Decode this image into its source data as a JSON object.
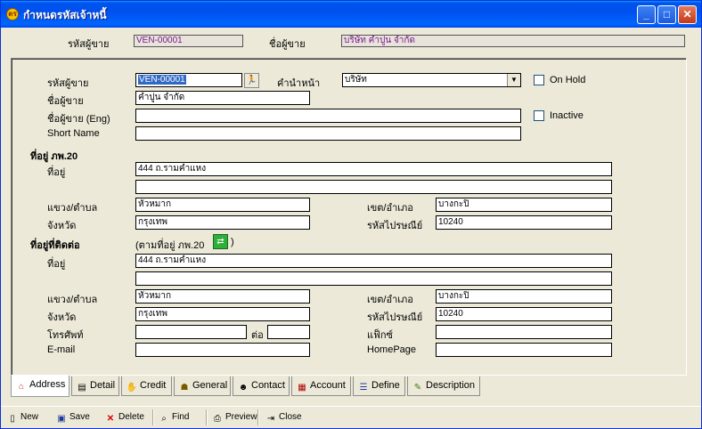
{
  "window": {
    "title": "กำหนดรหัสเจ้าหนี้",
    "app_icon_text": "ตร",
    "min": "_",
    "max": "□",
    "close": "✕"
  },
  "header": {
    "vendor_code_label": "รหัสผู้ขาย",
    "vendor_code": "VEN-00001",
    "vendor_name_label": "ชื่อผู้ขาย",
    "vendor_name": "บริษัท คำปูน จำกัด"
  },
  "form": {
    "vendor_code_label": "รหัสผู้ขาย",
    "vendor_code": "VEN-00001",
    "prefix_label": "คำนำหน้า",
    "prefix_value": "บริษัท",
    "on_hold_label": "On Hold",
    "name_label": "ชื่อผู้ขาย",
    "name_value": "คำปูน จำกัด",
    "name_eng_label": "ชื่อผู้ขาย (Eng)",
    "name_eng_value": "",
    "inactive_label": "Inactive",
    "short_name_label": "Short Name",
    "short_name_value": ""
  },
  "tax_address": {
    "section_title": "ที่อยู่ ภพ.20",
    "address_label": "ที่อยู่",
    "address_line1": "444  ถ.รามคำแหง",
    "address_line2": "",
    "subdistrict_label": "แขวง/ตำบล",
    "subdistrict": "หัวหมาก",
    "district_label": "เขต/อำเภอ",
    "district": "บางกะปิ",
    "province_label": "จังหวัด",
    "province": "กรุงเทพ",
    "postcode_label": "รหัสไปรษณีย์",
    "postcode": "10240"
  },
  "contact_address": {
    "section_title": "ที่อยู่ที่ติดต่อ",
    "same_as_label_open": "(ตามที่อยู่ ภพ.20",
    "same_as_label_close": ")",
    "address_label": "ที่อยู่",
    "address_line1": "444  ถ.รามคำแหง",
    "address_line2": "",
    "subdistrict_label": "แขวง/ตำบล",
    "subdistrict": "หัวหมาก",
    "district_label": "เขต/อำเภอ",
    "district": "บางกะปิ",
    "province_label": "จังหวัด",
    "province": "กรุงเทพ",
    "postcode_label": "รหัสไปรษณีย์",
    "postcode": "10240",
    "phone_label": "โทรศัพท์",
    "phone": "",
    "ext_label": "ต่อ",
    "ext": "",
    "fax_label": "แฟ็กซ์",
    "fax": "",
    "email_label": "E-mail",
    "email": "",
    "homepage_label": "HomePage",
    "homepage": ""
  },
  "tabs": [
    "Address",
    "Detail",
    "Credit",
    "General",
    "Contact",
    "Account",
    "Define",
    "Description"
  ],
  "toolbar": {
    "new": "New",
    "save": "Save",
    "delete": "Delete",
    "find": "Find",
    "preview": "Preview",
    "close": "Close"
  },
  "colors": {
    "titlebar": "#0054e3",
    "dialog_bg": "#ece9d8",
    "readonly_text": "#7a1a8a",
    "selection": "#316ac5"
  }
}
